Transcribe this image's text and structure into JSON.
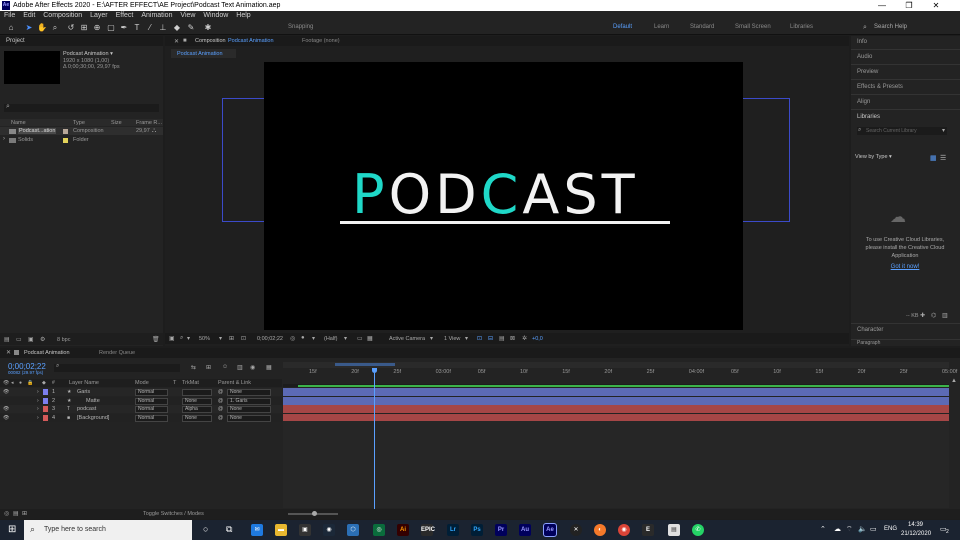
{
  "window": {
    "app_icon": "Ae",
    "title": "Adobe After Effects 2020 - E:\\AFTER EFFECT\\AE Project\\Podcast Text Animation.aep",
    "controls": [
      "minimize-icon",
      "maximize-icon",
      "close-icon"
    ]
  },
  "menu": [
    "File",
    "Edit",
    "Composition",
    "Layer",
    "Effect",
    "Animation",
    "View",
    "Window",
    "Help"
  ],
  "toolbar": {
    "snapping_label": "Snapping",
    "workspaces": [
      "Default",
      "Learn",
      "Standard",
      "Small Screen",
      "Libraries"
    ],
    "active_workspace": "Default",
    "search_placeholder": "Search Help"
  },
  "project_panel": {
    "title": "Project",
    "comp_name": "Podcast Animation ▾",
    "comp_res": "1920 x 1080 (1,00)",
    "comp_dur": "Δ 0;00;30;00, 29,97 fps",
    "columns": [
      "Name",
      "Type",
      "Size",
      "Frame R..."
    ],
    "items": [
      {
        "name": "Podcast...ation",
        "type": "Composition",
        "size": "",
        "fps": "29,97",
        "color": "#b8a899"
      },
      {
        "name": "Solids",
        "type": "Folder",
        "size": "",
        "fps": "",
        "color": "#e3d35a"
      }
    ],
    "bpc": "8 bpc"
  },
  "composition_panel": {
    "tab_label": "Composition",
    "tab_comp": "Podcast Animation",
    "footage_label": "Footage (none)",
    "breadcrumb": "Podcast Animation",
    "canvas_text_parts": [
      {
        "text": "P",
        "color": "#1fd8c8"
      },
      {
        "text": "OD",
        "color": "#f2f2f2"
      },
      {
        "text": "C",
        "color": "#1fd8c8"
      },
      {
        "text": "AST",
        "color": "#f2f2f2"
      }
    ],
    "zoom": "50%",
    "timecode": "0;00;02;22",
    "resolution": "(Half)",
    "camera": "Active Camera",
    "view": "1 View",
    "exposure": "+0,0"
  },
  "right_panel": {
    "items": [
      "Info",
      "Audio",
      "Preview",
      "Effects & Presets",
      "Align"
    ],
    "libraries_title": "Libraries",
    "libraries_search_placeholder": "Search Current Library",
    "view_by": "View by Type ▾",
    "cc_message": "To use Creative Cloud Libraries, please install the Creative Cloud Application",
    "cc_link": "Got it now!",
    "kb": "-- KB",
    "character": "Character",
    "paragraph": "Paragraph"
  },
  "timeline": {
    "tab_comp": "Podcast Animation",
    "render_queue": "Render Queue",
    "timecode": "0;00;02;22",
    "frame_info": "00082 (29.97 fps)",
    "headers": {
      "layer_name": "Layer Name",
      "mode": "Mode",
      "t": "T",
      "trkmat": "TrkMat",
      "parent": "Parent & Link"
    },
    "ruler": [
      "15f",
      "20f",
      "25f",
      "03:00f",
      "05f",
      "10f",
      "15f",
      "20f",
      "25f",
      "04:00f",
      "05f",
      "10f",
      "15f",
      "20f",
      "25f",
      "05:00f"
    ],
    "layers": [
      {
        "num": "1",
        "name": "Garis",
        "mode": "Normal",
        "trkmat": "",
        "parent": "None",
        "color": "#7c7ff0",
        "bar": "#5c6ab5",
        "icon": "★"
      },
      {
        "num": "2",
        "name": "Matte",
        "mode": "Normal",
        "trkmat": "None",
        "parent": "1. Garis",
        "color": "#7c7ff0",
        "bar": "#5c6ab5",
        "icon": "★"
      },
      {
        "num": "3",
        "name": "podcast",
        "mode": "Normal",
        "trkmat": "Alpha",
        "parent": "None",
        "color": "#d45a5a",
        "bar": "#a54646",
        "icon": "T"
      },
      {
        "num": "4",
        "name": "[Background]",
        "mode": "Normal",
        "trkmat": "None",
        "parent": "None",
        "color": "#d45a5a",
        "bar": "#a54646",
        "icon": "■"
      }
    ],
    "toggle_label": "Toggle Switches / Modes"
  },
  "taskbar": {
    "search_placeholder": "Type here to search",
    "language": "ENG",
    "time": "14:39",
    "date": "21/12/2020",
    "notification_count": "2",
    "apps": [
      {
        "label": "Ai",
        "color": "#330000",
        "fg": "#ff9a00"
      },
      {
        "label": "EPIC",
        "color": "#2a2a2a",
        "fg": "#fff"
      },
      {
        "label": "Lr",
        "color": "#001e36",
        "fg": "#31a8ff"
      },
      {
        "label": "Ps",
        "color": "#001e36",
        "fg": "#31a8ff"
      },
      {
        "label": "Pr",
        "color": "#00005b",
        "fg": "#9999ff"
      },
      {
        "label": "Au",
        "color": "#00005b",
        "fg": "#9999ff"
      },
      {
        "label": "Ae",
        "color": "#00005b",
        "fg": "#9999ff"
      }
    ]
  }
}
